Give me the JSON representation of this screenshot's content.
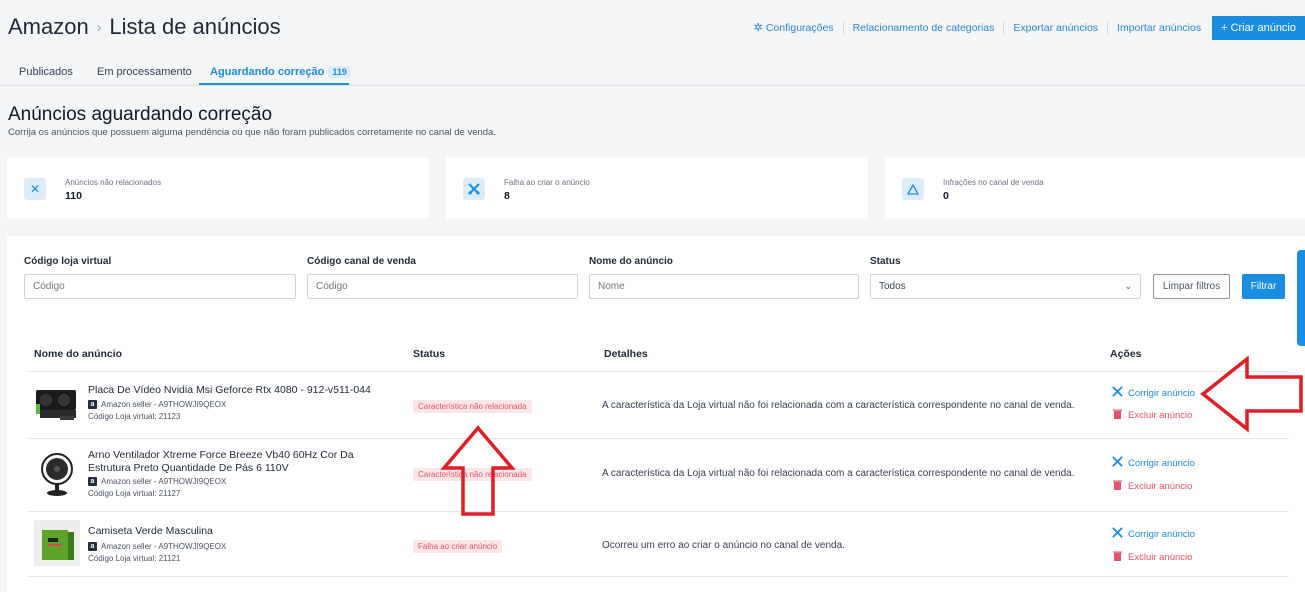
{
  "header": {
    "app": "Amazon",
    "separator": "›",
    "page": "Lista de anúncios",
    "actions": {
      "settings": "Configurações",
      "categories": "Relacionamento de categorias",
      "export": "Exportar anúncios",
      "import": "Importar anúncios",
      "create": "+ Criar anúncio"
    }
  },
  "tabs": {
    "published": "Publicados",
    "processing": "Em processamento",
    "awaiting": "Aguardando correção",
    "awaiting_count": "119"
  },
  "section": {
    "title": "Anúncios aguardando correção",
    "subtitle": "Corrija os anúncios que possuem alguma pendência ou que não foram publicados corretamente no canal de venda."
  },
  "cards": [
    {
      "icon": "close-icon",
      "label": "Anúncios não relacionados",
      "value": "110"
    },
    {
      "icon": "tools-icon",
      "label": "Falha ao criar o anúncio",
      "value": "8"
    },
    {
      "icon": "warning-icon",
      "label": "Infrações no canal de venda",
      "value": "0"
    }
  ],
  "filters": {
    "store_code_label": "Código loja virtual",
    "store_code_placeholder": "Código",
    "channel_code_label": "Código canal de venda",
    "channel_code_placeholder": "Código",
    "name_label": "Nome do anúncio",
    "name_placeholder": "Nome",
    "status_label": "Status",
    "status_value": "Todos",
    "clear": "Limpar filtros",
    "filter": "Filtrar"
  },
  "table": {
    "columns": {
      "name": "Nome do anúncio",
      "status": "Status",
      "details": "Detalhes",
      "actions": "Ações"
    },
    "fix_label": "Corrigir anúncio",
    "delete_label": "Excluir anúncio",
    "rows": [
      {
        "name": "Placa De Vídeo Nvidia Msi Geforce Rtx 4080 - 912-v511-044",
        "seller": "Amazon seller - A9THOWJI9QEOX",
        "code": "Código Loja virtual: 21123",
        "status": "Característica não relacionada",
        "details": "A característica da Loja virtual não foi relacionada com a característica correspondente no canal de venda."
      },
      {
        "name": "Arno Ventilador Xtreme Force Breeze Vb40 60Hz Cor Da Estrutura Preto Quantidade De Pás 6 110V",
        "seller": "Amazon seller - A9THOWJI9QEOX",
        "code": "Código Loja virtual: 21127",
        "status": "Característica não relacionada",
        "details": "A característica da Loja virtual não foi relacionada com a característica correspondente no canal de venda."
      },
      {
        "name": "Camiseta Verde Masculina",
        "seller": "Amazon seller - A9THOWJI9QEOX",
        "code": "Código Loja virtual: 21121",
        "status": "Falha ao criar anúncio",
        "details": "Ocorreu um erro ao criar o anúncio no canal de venda."
      }
    ]
  },
  "colors": {
    "accent": "#1a8de0",
    "danger": "#e4526b",
    "annotation": "#e01e26"
  }
}
